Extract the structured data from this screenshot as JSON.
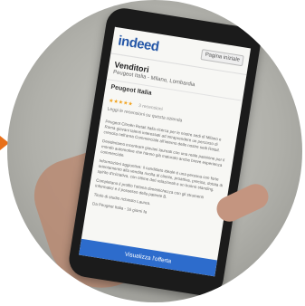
{
  "screen": {
    "brand": "indeed",
    "home_button": "Pagina iniziale",
    "job_title": "Venditori",
    "job_subtitle": "Peugeot Italia - Milano, Lombardia",
    "company": "Peugeot Italia",
    "rating_stars": "★★★★★",
    "reviews": "3 recensioni",
    "company_link": "Leggi le recensioni su questa azienda",
    "paragraphs": [
      "Peugeot Citroën Retail Italia ricerca per le nostre sedi di Milano e Roma giovani talenti interessati ad intraprendere un percorso di crescita nell'area Commerciale all'interno delle nostre sedi Retail.",
      "Desideriamo incontrare giovani laureati con una reale passione per il mondo automotive che hanno già maturato anche breve esperienza commerciale.",
      "Informazioni aggiuntive: il candidato ideale è una persona con forte orientamento alla vendita rivolta al cliente, proattiva, precisa, dotata di spirito d'iniziativa, con ottime doti relazionali e un buono standing.",
      "Completano il profilo l'ottima dimestichezza con gli strumenti informatici e il possesso della patente B.",
      "Titolo di studio richiesto Laurea."
    ],
    "footer_meta": "Da Peugeot Italia - 16 giorni fa",
    "apply_button": "Visualizza l'offerta"
  },
  "colors": {
    "brand": "#2557a7",
    "accent": "#e8701a",
    "button": "#2d6ccc"
  }
}
